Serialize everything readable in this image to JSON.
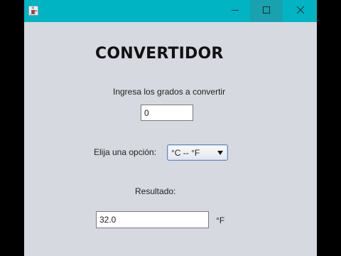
{
  "titlebar": {
    "icons": {
      "app": "java-cup-icon",
      "minimize": "minimize-icon",
      "maximize": "maximize-icon",
      "close": "close-icon"
    },
    "color": "#00b4c3"
  },
  "main": {
    "heading": "CONVERTIDOR",
    "prompt": "Ingresa los grados a convertir",
    "degrees_value": "0",
    "option_label": "Elija una opción:",
    "selected_option": "°C -- °F",
    "result_label": "Resultado:",
    "result_value": "32.0",
    "result_unit": "°F"
  },
  "colors": {
    "window_background": "#d6d9df",
    "select_border": "#5c8bbf"
  }
}
